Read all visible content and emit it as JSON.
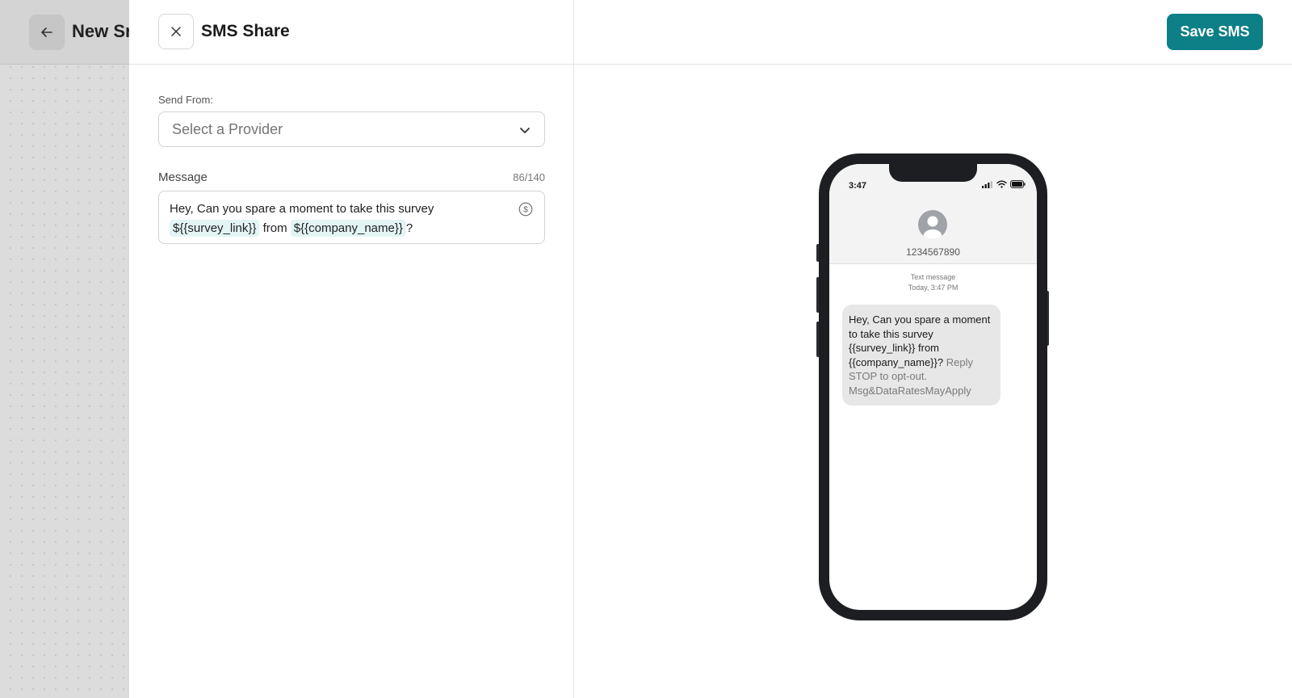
{
  "background": {
    "title": "New Sr"
  },
  "drawer": {
    "title": "SMS Share",
    "save_label": "Save SMS"
  },
  "form": {
    "send_from_label": "Send From:",
    "provider_placeholder": "Select a Provider",
    "message_label": "Message",
    "counter": "86/140",
    "message": {
      "prefix": "Hey, Can you spare a moment to take this survey",
      "token1": "${{survey_link}}",
      "middle": "from",
      "token2": "${{company_name}}",
      "suffix": "?"
    }
  },
  "preview": {
    "time": "3:47",
    "phone_number": "1234567890",
    "meta_line1": "Text message",
    "meta_line2": "Today, 3:47 PM",
    "bubble_main": "Hey, Can you spare a moment to take this survey {{survey_link}} from {{company_name}}?",
    "bubble_suffix": "Reply STOP to opt-out. Msg&DataRatesMayApply"
  },
  "colors": {
    "accent": "#0d7f86",
    "token_bg": "#e3f4f5"
  }
}
